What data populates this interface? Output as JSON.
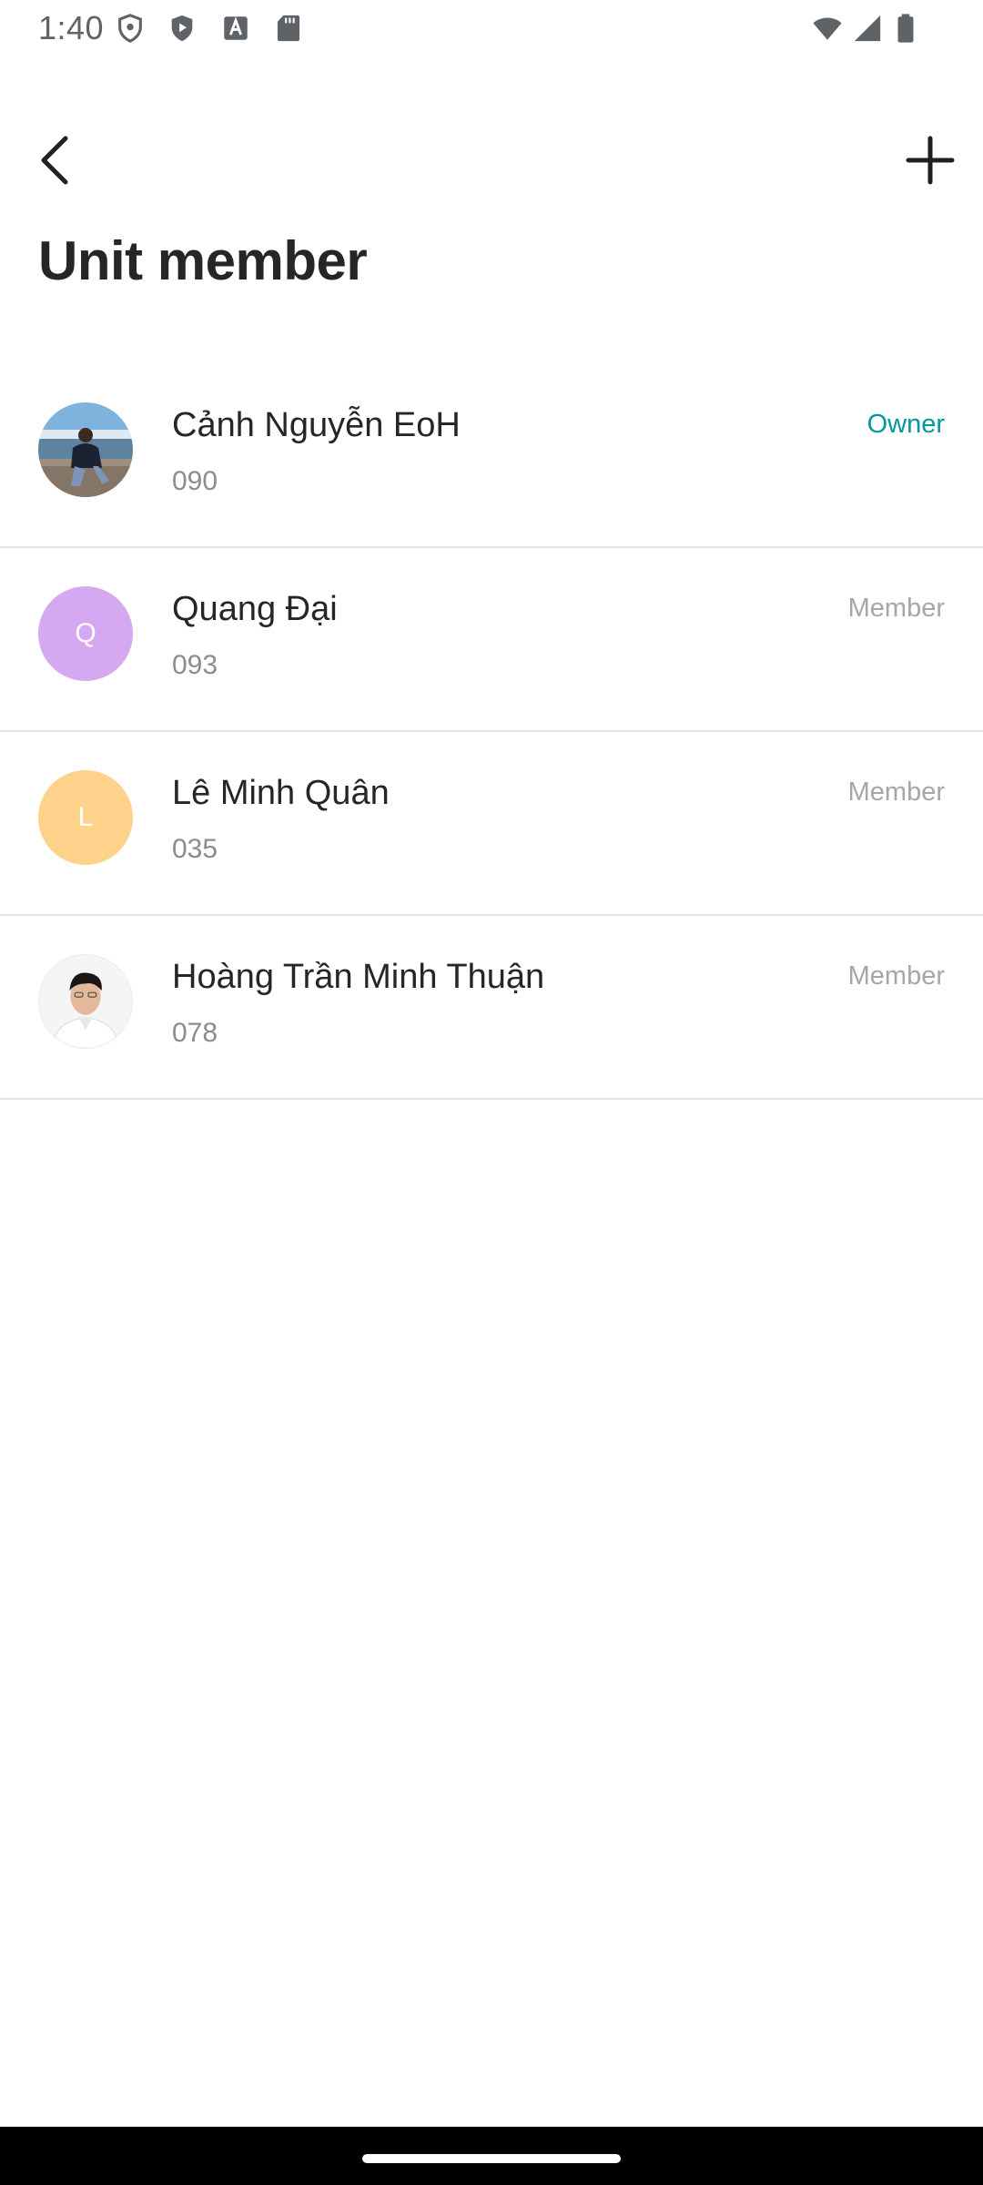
{
  "status_bar": {
    "time": "1:40",
    "icons": [
      "shield-icon",
      "play-protect-icon",
      "text-a-icon",
      "sd-card-icon",
      "wifi-icon",
      "signal-icon",
      "battery-icon"
    ]
  },
  "header": {
    "back_icon": "chevron-left-icon",
    "add_icon": "plus-icon",
    "title": "Unit member"
  },
  "members": [
    {
      "name": "Cảnh Nguyễn EoH",
      "phone": "090",
      "role": "Owner",
      "avatar": "photo",
      "role_color": "#00979D"
    },
    {
      "name": "Quang Đại",
      "phone": "093",
      "role": "Member",
      "avatar": "Q",
      "avatar_color": "#D5A8F2"
    },
    {
      "name": "Lê Minh Quân",
      "phone": "035",
      "role": "Member",
      "avatar": "L",
      "avatar_color": "#FFD28C"
    },
    {
      "name": "Hoàng Trần Minh Thuận",
      "phone": "078",
      "role": "Member",
      "avatar": "photo"
    }
  ]
}
